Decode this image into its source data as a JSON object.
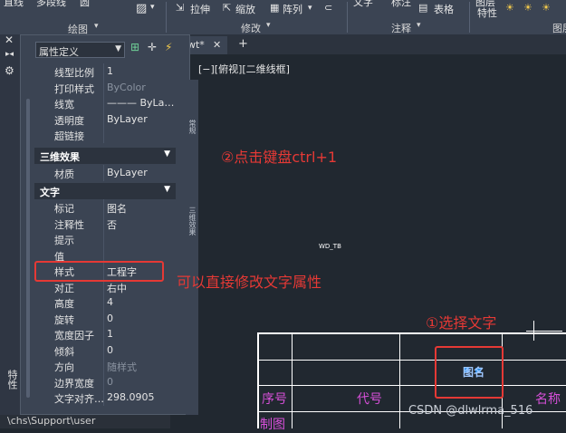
{
  "ribbon": {
    "top_partial_labels": [
      "直线",
      "多段线",
      "圆"
    ],
    "draw_group": "绘图",
    "modify_items": [
      "拉伸",
      "缩放",
      "阵列"
    ],
    "modify_group": "修改",
    "annotation_items": [
      "文字",
      "标注",
      "表格"
    ],
    "annotation_group": "注释",
    "props_item": "特性",
    "layers_group": "图层"
  },
  "tabs": {
    "current": "wt*",
    "close": "✕",
    "add": "+"
  },
  "viewport_label": "[−][俯视][二维线框]",
  "palette": {
    "vertical_title": "特性",
    "selector": "属性定义",
    "rows_general": [
      {
        "k": "线型比例",
        "v": "1",
        "dim": false
      },
      {
        "k": "打印样式",
        "v": "ByColor",
        "dim": true
      },
      {
        "k": "线宽",
        "v": "——— ByLa…",
        "dim": false
      },
      {
        "k": "透明度",
        "v": "ByLayer",
        "dim": false
      },
      {
        "k": "超链接",
        "v": "",
        "dim": false
      }
    ],
    "section_3d": "三维效果",
    "rows_3d": [
      {
        "k": "材质",
        "v": "ByLayer",
        "dim": false
      }
    ],
    "section_text": "文字",
    "rows_text": [
      {
        "k": "标记",
        "v": "图名",
        "dim": false
      },
      {
        "k": "注释性",
        "v": "否",
        "dim": false
      },
      {
        "k": "提示",
        "v": "",
        "dim": false
      },
      {
        "k": "值",
        "v": "",
        "dim": false
      },
      {
        "k": "样式",
        "v": "工程字",
        "dim": false
      },
      {
        "k": "对正",
        "v": "右中",
        "dim": false
      },
      {
        "k": "高度",
        "v": "4",
        "dim": false
      },
      {
        "k": "旋转",
        "v": "0",
        "dim": false
      },
      {
        "k": "宽度因子",
        "v": "1",
        "dim": false
      },
      {
        "k": "倾斜",
        "v": "0",
        "dim": false
      },
      {
        "k": "方向",
        "v": "随样式",
        "dim": true
      },
      {
        "k": "边界宽度",
        "v": "0",
        "dim": true
      },
      {
        "k": "文字对齐…",
        "v": "298.0905",
        "dim": false
      }
    ]
  },
  "annotations": {
    "step2": "②点击键盘ctrl+1",
    "modify_hint": "可以直接修改文字属性",
    "step1": "①选择文字"
  },
  "drawing": {
    "small_text": "WD_TB",
    "attr_tag": "图名",
    "col_seq": "序号",
    "col_code": "代号",
    "col_name": "名称",
    "row_draw": "制图"
  },
  "cmdline": "\\chs\\Support\\user",
  "watermark": "CSDN @dlwlrma_516",
  "colors": {
    "ribbon": "#3b4453",
    "canvas": "#212830",
    "annotation_red": "#e53935",
    "magenta": "#d64fd8",
    "selection_blue": "#1e88e5"
  }
}
